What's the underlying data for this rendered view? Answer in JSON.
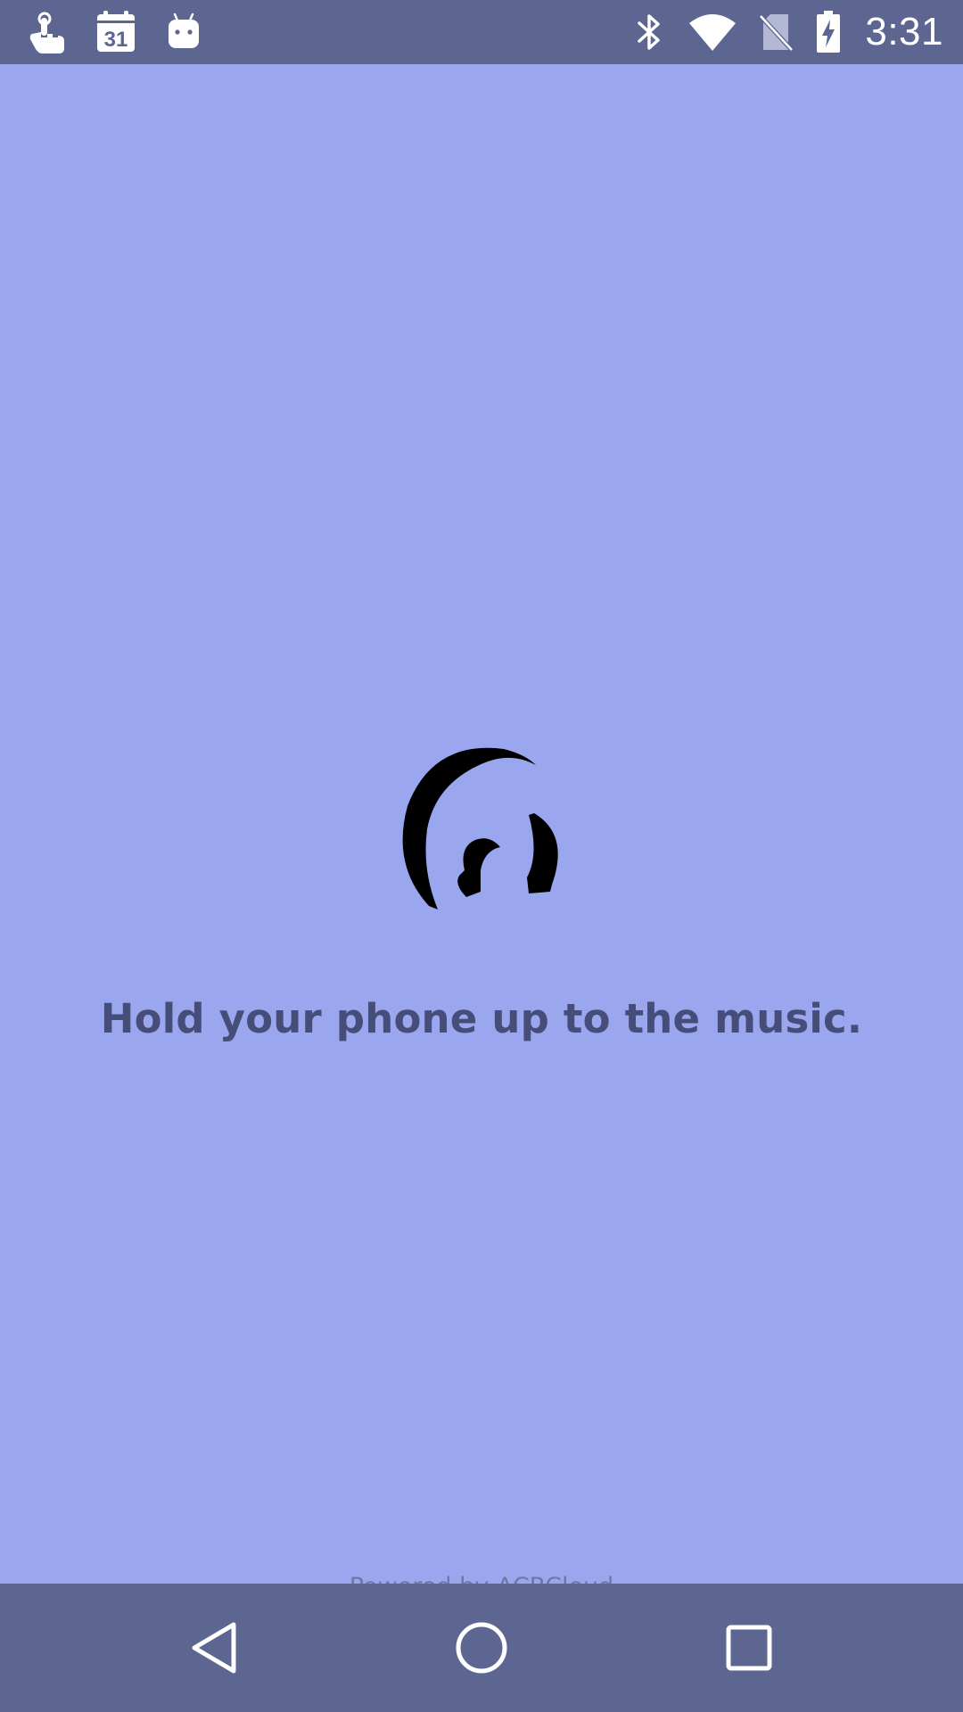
{
  "status_bar": {
    "notification_icons": [
      "touch-gesture-icon",
      "calendar-icon",
      "android-robot-icon"
    ],
    "calendar_day": "31",
    "system_icons": [
      "bluetooth-icon",
      "wifi-icon",
      "no-sim-icon",
      "battery-charging-icon"
    ],
    "time": "3:31"
  },
  "main": {
    "logo_icon": "listening-ear-icon",
    "headline": "Hold your phone up to the music.",
    "powered_by": "Powered by ACRCloud"
  },
  "nav_bar": {
    "buttons": [
      "back-icon",
      "home-icon",
      "recents-icon"
    ]
  },
  "colors": {
    "background": "#9aa7ee",
    "bars": "#5d6591",
    "headline": "#464d79",
    "powered_by": "#6f77a7"
  }
}
